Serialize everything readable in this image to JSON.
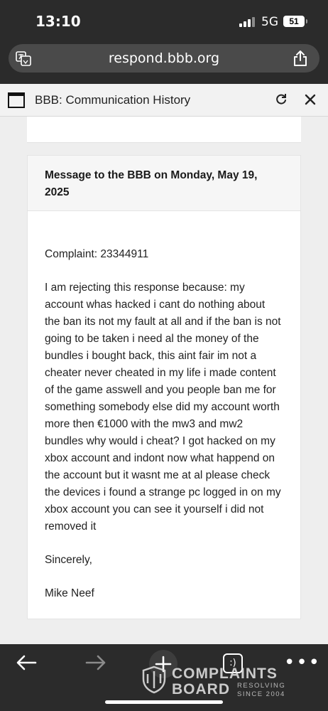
{
  "status_bar": {
    "time": "13:10",
    "network": "5G",
    "battery": "51"
  },
  "browser": {
    "url": "respond.bbb.org",
    "translate_icon": "translate-icon",
    "share_icon": "share-icon"
  },
  "viewer": {
    "title": "BBB: Communication History",
    "reload_icon": "reload-icon",
    "close_icon": "close-icon"
  },
  "message": {
    "header": "Message to the BBB on Monday, May 19, 2025",
    "complaint": "Complaint: 23344911",
    "body": "I am rejecting this response because: my account whas hacked i cant do nothing about the ban its not my fault at all and if the ban is not going to be taken i need al the money of the bundles i bought back, this aint fair im not a cheater never cheated in my life i made content of the game asswell and you people ban me for something somebody else did my account worth more then €1000 with the mw3 and mw2 bundles why would i cheat? I got hacked on my xbox account and indont now what happend on the account but it wasnt me at al please check the devices i found a strange pc logged in on my xbox account you can see it yourself i did not removed it",
    "closing": "Sincerely,",
    "signature": "Mike Neef"
  },
  "toolbar": {
    "tabs_label": ":)",
    "more_label": "•••"
  },
  "watermark": {
    "line1": "COMPLAINTS",
    "line2": "BOARD",
    "tag1": "RESOLVING",
    "tag2": "SINCE 2004"
  }
}
